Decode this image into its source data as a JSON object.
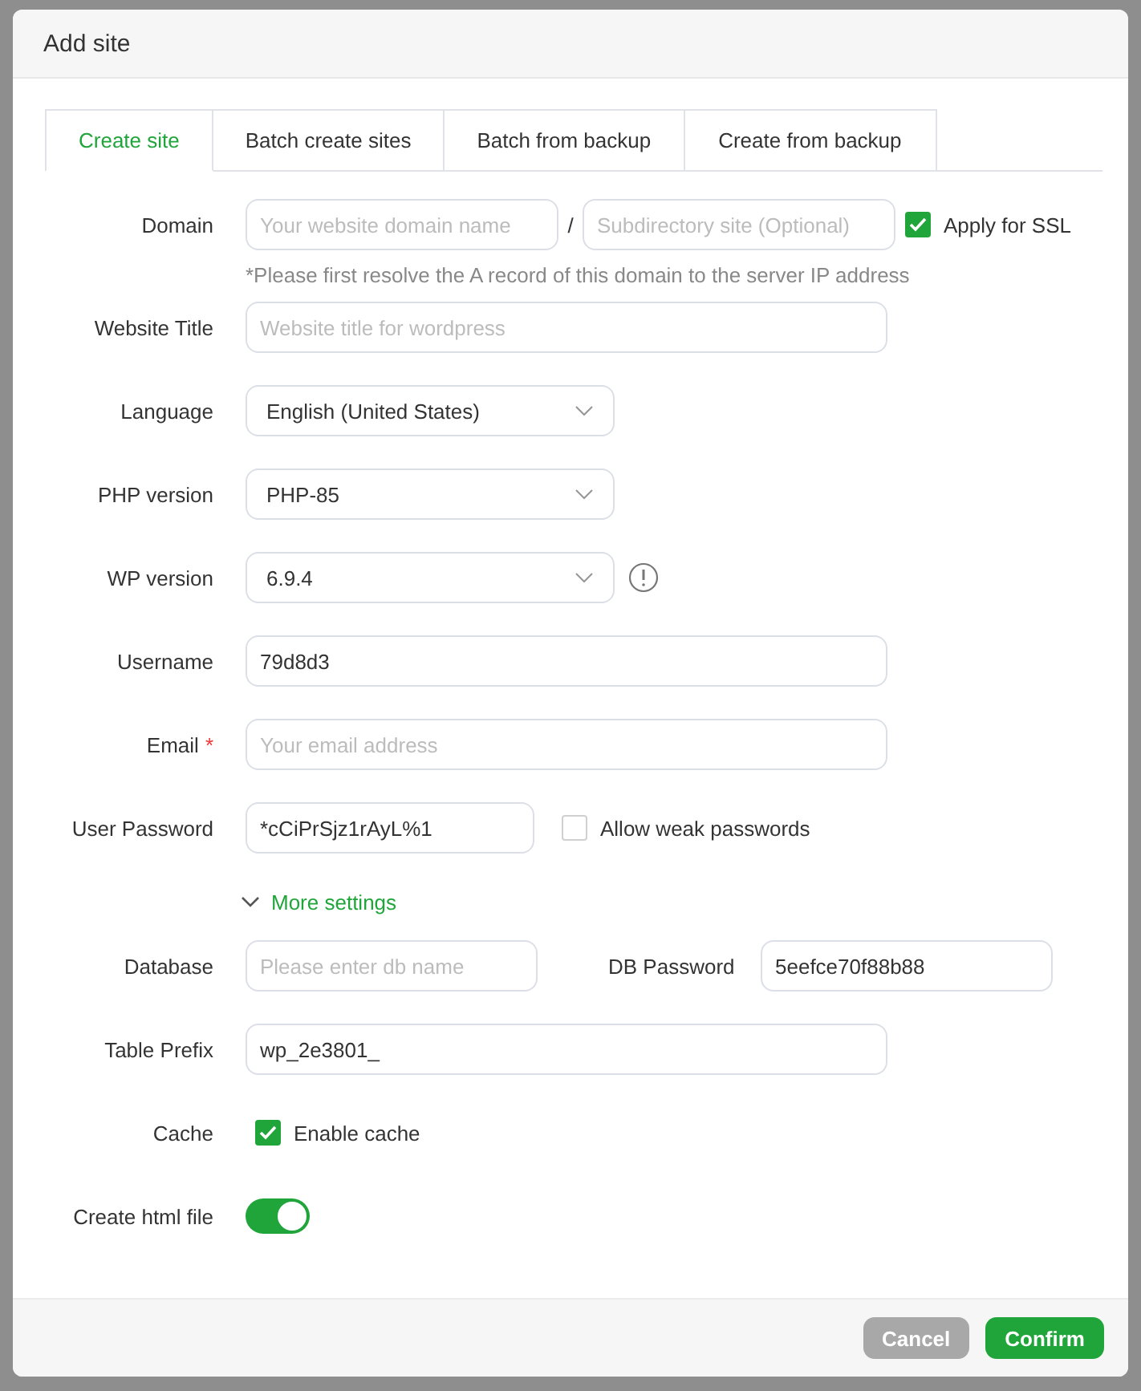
{
  "dialog": {
    "title": "Add site"
  },
  "tabs": [
    {
      "label": "Create site",
      "selected": true
    },
    {
      "label": "Batch create sites",
      "selected": false
    },
    {
      "label": "Batch from backup",
      "selected": false
    },
    {
      "label": "Create from backup",
      "selected": false
    }
  ],
  "rows": [
    {
      "kind": "domain",
      "label": "Domain",
      "inputs": [
        {
          "placeholder": "Your website domain name"
        },
        {
          "placeholder": "Subdirectory site (Optional)"
        }
      ],
      "separator": "/",
      "checkbox": {
        "label": "Apply for SSL",
        "checked": true
      },
      "hint": "*Please first resolve the A record of this domain to the server IP address"
    },
    {
      "kind": "text",
      "label": "Website Title",
      "placeholder": "Website title for wordpress"
    },
    {
      "kind": "select",
      "label": "Language",
      "value": "English (United States)"
    },
    {
      "kind": "select",
      "label": "PHP version",
      "value": "PHP-85"
    },
    {
      "kind": "select",
      "label": "WP version",
      "value": "6.9.4",
      "info": true
    },
    {
      "kind": "text",
      "label": "Username",
      "value": "79d8d3"
    },
    {
      "kind": "text",
      "label": "Email",
      "required_mark": "*",
      "placeholder": "Your email address"
    },
    {
      "kind": "password",
      "label": "User Password",
      "value": "*cCiPrSjz1rAyL%1",
      "checkbox": {
        "label": "Allow weak passwords",
        "checked": false
      }
    },
    {
      "kind": "expander",
      "label": "More settings",
      "expanded": true
    },
    {
      "kind": "pair",
      "label": "Database",
      "placeholder": "Please enter db name",
      "label2": "DB Password",
      "value2": "5eefce70f88b88"
    },
    {
      "kind": "text",
      "label": "Table Prefix",
      "value": "wp_2e3801_"
    },
    {
      "kind": "checkbox",
      "label": "Cache",
      "checkbox": {
        "label": "Enable cache",
        "checked": true
      }
    },
    {
      "kind": "toggle",
      "label": "Create html file",
      "on": true
    }
  ],
  "buttons": [
    {
      "label": "Cancel",
      "disabled": true
    },
    {
      "label": "Confirm",
      "disabled": false
    }
  ]
}
